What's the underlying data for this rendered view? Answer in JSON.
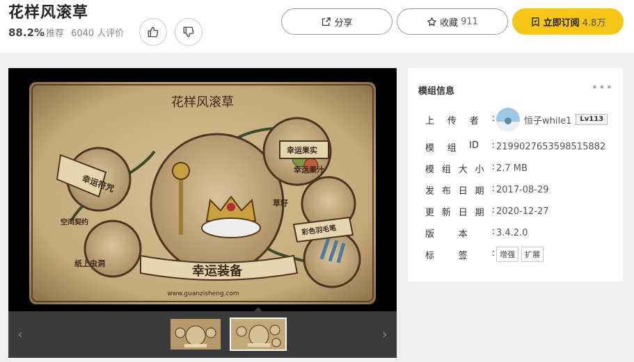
{
  "header": {
    "title": "花样风滚草",
    "rating_pct": "88.2%",
    "rating_label": "推荐",
    "review_count": "6040 人评价",
    "share_label": "分享",
    "fav_label": "收藏",
    "fav_count": "911",
    "subscribe_label": "立即订阅",
    "subscribe_count": "4.8万"
  },
  "preview": {
    "poster_title": "花样风滚草",
    "poster_labels": {
      "lucky_curse": "幸运符咒",
      "space_contract": "空间契约",
      "paper_bug_hole": "纸上虫洞",
      "lucky_fruit": "幸运果实",
      "lucky_juice": "幸运果汁",
      "seed": "草籽",
      "feather_pen": "彩色羽毛笔",
      "lucky_gear": "幸运装备",
      "website": "www.guanzisheng.com"
    }
  },
  "info": {
    "title": "模组信息",
    "rows": [
      {
        "k": [
          "上",
          "传",
          "者",
          ":"
        ],
        "v": "恒子while1"
      },
      {
        "k": [
          "模",
          "组",
          "ID",
          ":"
        ],
        "v": "2199027653598515882"
      },
      {
        "k": [
          "模",
          "组",
          "大",
          "小",
          ":"
        ],
        "v": "2.7 MB"
      },
      {
        "k": [
          "发",
          "布",
          "日",
          "期",
          ":"
        ],
        "v": "2017-08-29"
      },
      {
        "k": [
          "更",
          "新",
          "日",
          "期",
          ":"
        ],
        "v": "2020-12-27"
      },
      {
        "k": [
          "版",
          "本",
          ":"
        ],
        "v": "3.4.2.0"
      },
      {
        "k": [
          "标",
          "签",
          ":"
        ],
        "v": ""
      }
    ],
    "uploader_level": "Lv113",
    "tags": [
      "增强",
      "扩展"
    ]
  },
  "colors": {
    "accent": "#f5c518",
    "parchment": "#c9ae82"
  }
}
